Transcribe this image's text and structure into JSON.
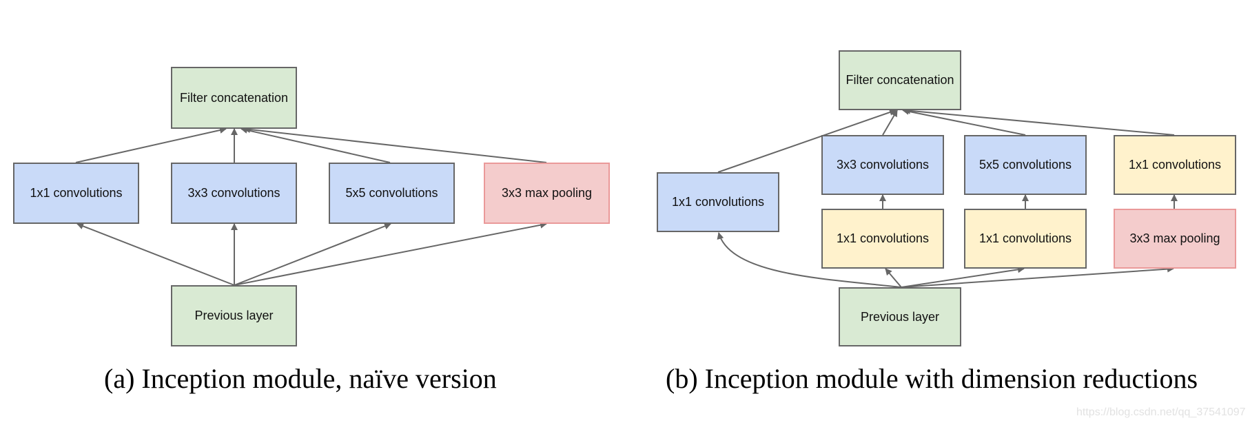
{
  "panel_a": {
    "caption": "(a)  Inception module, naïve version",
    "nodes": {
      "filter_concat": "Filter concatenation",
      "conv1x1": "1x1 convolutions",
      "conv3x3": "3x3 convolutions",
      "conv5x5": "5x5 convolutions",
      "maxpool": "3x3 max pooling",
      "previous": "Previous layer"
    }
  },
  "panel_b": {
    "caption": "(b)  Inception module with dimension reductions",
    "nodes": {
      "filter_concat": "Filter concatenation",
      "conv1x1": "1x1 convolutions",
      "conv3x3": "3x3 convolutions",
      "conv5x5": "5x5 convolutions",
      "conv1x1_after_pool": "1x1 convolutions",
      "reduce_3x3": "1x1 convolutions",
      "reduce_5x5": "1x1 convolutions",
      "maxpool": "3x3 max pooling",
      "previous": "Previous layer"
    }
  },
  "legend_colors": {
    "input_output": "#d9ead3",
    "convolution": "#c9daf8",
    "reduction": "#fff2cc",
    "pooling": "#f4cccc",
    "edge": "#666666"
  },
  "watermark": "https://blog.csdn.net/qq_37541097"
}
